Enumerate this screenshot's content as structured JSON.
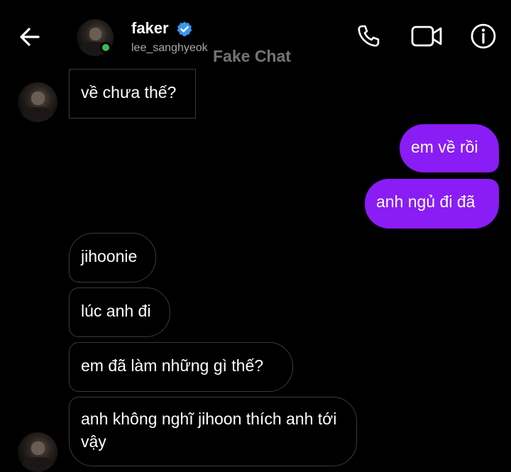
{
  "header": {
    "display_name": "faker",
    "username": "lee_sanghyeok",
    "watermark": "Fake Chat",
    "icons": {
      "back": "arrow-left-icon",
      "verified": "verified-badge-icon",
      "call": "phone-icon",
      "video": "video-camera-icon",
      "info": "info-icon"
    },
    "verified_color": "#3897f0",
    "online_status_color": "#3fb950"
  },
  "messages": [
    {
      "sender": "them",
      "text": "về chưa thế?"
    },
    {
      "sender": "me",
      "text": "em về rồi"
    },
    {
      "sender": "me",
      "text": "anh ngủ đi đã"
    },
    {
      "sender": "them",
      "text": "jihoonie"
    },
    {
      "sender": "them",
      "text": "lúc anh đi"
    },
    {
      "sender": "them",
      "text": "em đã làm những gì thế?"
    },
    {
      "sender": "them",
      "text": "anh không nghĩ jihoon thích anh tới vậy"
    }
  ],
  "colors": {
    "outgoing_bubble": "#8a1cf5",
    "incoming_border": "#3a3a3a",
    "background": "#000000"
  }
}
